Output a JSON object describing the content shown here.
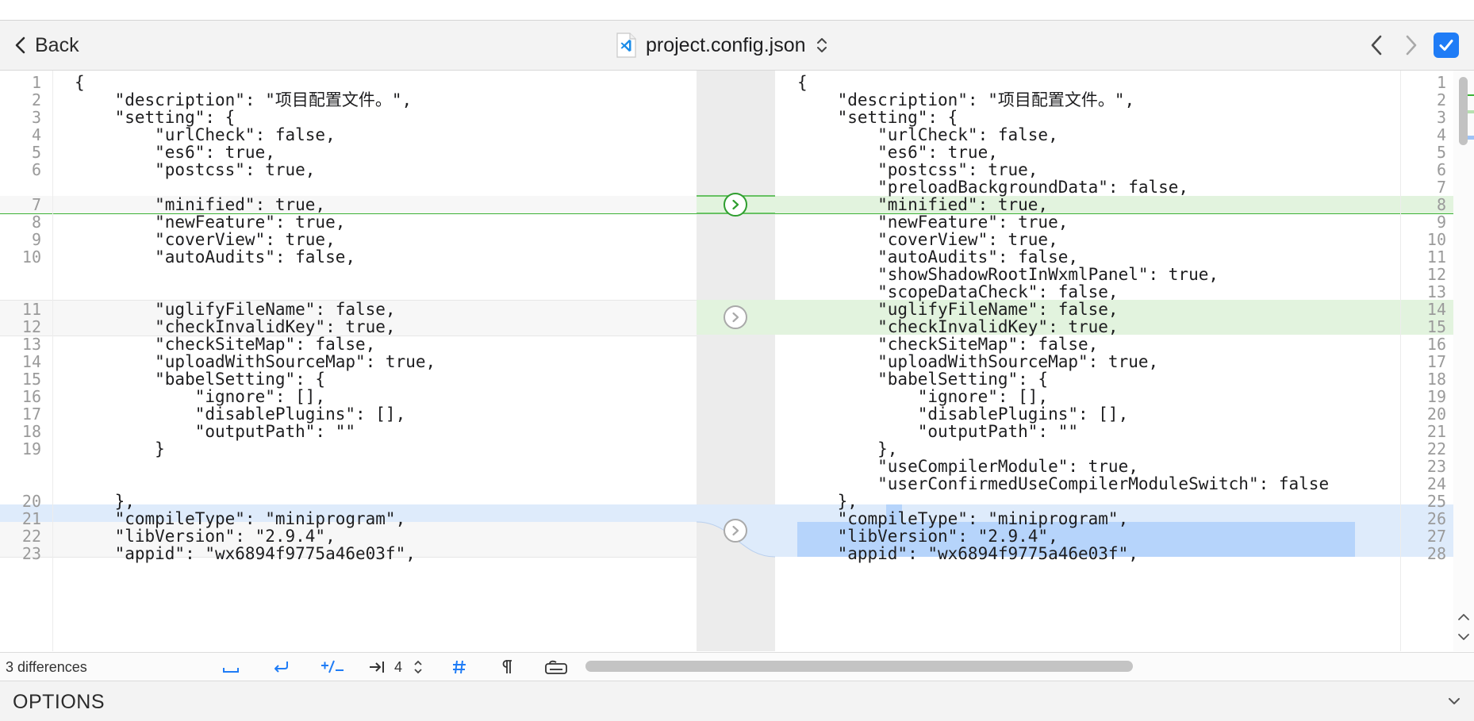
{
  "toolbar": {
    "back_label": "Back",
    "title": "project.config.json",
    "file_icon": "vscode-file-icon",
    "checkbox_checked": true,
    "check_color": "#1f7cf6"
  },
  "colors": {
    "added_bg": "#e2f3de",
    "added_line": "#3db236",
    "selected_bg": "#deebfb",
    "selection_bg": "#b6d4fb"
  },
  "left_lines": [
    {
      "n": "1",
      "t": "{"
    },
    {
      "n": "2",
      "t": "    \"description\": \"项目配置文件。\","
    },
    {
      "n": "3",
      "t": "    \"setting\": {"
    },
    {
      "n": "4",
      "t": "        \"urlCheck\": false,"
    },
    {
      "n": "5",
      "t": "        \"es6\": true,"
    },
    {
      "n": "6",
      "t": "        \"postcss\": true,"
    },
    {
      "n": "7",
      "t": "        \"minified\": true,"
    },
    {
      "n": "8",
      "t": "        \"newFeature\": true,"
    },
    {
      "n": "9",
      "t": "        \"coverView\": true,"
    },
    {
      "n": "10",
      "t": "        \"autoAudits\": false,"
    },
    {
      "n": "11",
      "t": "        \"uglifyFileName\": false,"
    },
    {
      "n": "12",
      "t": "        \"checkInvalidKey\": true,"
    },
    {
      "n": "13",
      "t": "        \"checkSiteMap\": false,"
    },
    {
      "n": "14",
      "t": "        \"uploadWithSourceMap\": true,"
    },
    {
      "n": "15",
      "t": "        \"babelSetting\": {"
    },
    {
      "n": "16",
      "t": "            \"ignore\": [],"
    },
    {
      "n": "17",
      "t": "            \"disablePlugins\": [],"
    },
    {
      "n": "18",
      "t": "            \"outputPath\": \"\""
    },
    {
      "n": "19",
      "t": "        }"
    },
    {
      "n": "20",
      "t": "    },"
    },
    {
      "n": "21",
      "t": "    \"compileType\": \"miniprogram\","
    },
    {
      "n": "22",
      "t": "    \"libVersion\": \"2.9.4\","
    },
    {
      "n": "23",
      "t": "    \"appid\": \"wx6894f9775a46e03f\","
    }
  ],
  "right_lines": [
    {
      "n": "1",
      "t": "{"
    },
    {
      "n": "2",
      "t": "    \"description\": \"项目配置文件。\","
    },
    {
      "n": "3",
      "t": "    \"setting\": {"
    },
    {
      "n": "4",
      "t": "        \"urlCheck\": false,"
    },
    {
      "n": "5",
      "t": "        \"es6\": true,"
    },
    {
      "n": "6",
      "t": "        \"postcss\": true,"
    },
    {
      "n": "7",
      "t": "        \"preloadBackgroundData\": false,"
    },
    {
      "n": "8",
      "t": "        \"minified\": true,"
    },
    {
      "n": "9",
      "t": "        \"newFeature\": true,"
    },
    {
      "n": "10",
      "t": "        \"coverView\": true,"
    },
    {
      "n": "11",
      "t": "        \"autoAudits\": false,"
    },
    {
      "n": "12",
      "t": "        \"showShadowRootInWxmlPanel\": true,"
    },
    {
      "n": "13",
      "t": "        \"scopeDataCheck\": false,"
    },
    {
      "n": "14",
      "t": "        \"uglifyFileName\": false,"
    },
    {
      "n": "15",
      "t": "        \"checkInvalidKey\": true,"
    },
    {
      "n": "16",
      "t": "        \"checkSiteMap\": false,"
    },
    {
      "n": "17",
      "t": "        \"uploadWithSourceMap\": true,"
    },
    {
      "n": "18",
      "t": "        \"babelSetting\": {"
    },
    {
      "n": "19",
      "t": "            \"ignore\": [],"
    },
    {
      "n": "20",
      "t": "            \"disablePlugins\": [],"
    },
    {
      "n": "21",
      "t": "            \"outputPath\": \"\""
    },
    {
      "n": "22",
      "t": "        },"
    },
    {
      "n": "23",
      "t": "        \"useCompilerModule\": true,"
    },
    {
      "n": "24",
      "t": "        \"userConfirmedUseCompilerModuleSwitch\": false"
    },
    {
      "n": "25",
      "t": "    },"
    },
    {
      "n": "26",
      "t": "    \"compileType\": \"miniprogram\","
    },
    {
      "n": "27",
      "t": "    \"libVersion\": \"2.9.4\","
    },
    {
      "n": "28",
      "t": "    \"appid\": \"wx6894f9775a46e03f\","
    }
  ],
  "status": {
    "differences": "3 differences",
    "tab_width": "4",
    "icons": [
      "show-spaces-icon",
      "wrap-lines-icon",
      "diff-marker-icon",
      "tab-indent-icon",
      "line-numbers-icon",
      "paragraph-icon",
      "keyboard-icon"
    ]
  },
  "options": {
    "label": "OPTIONS"
  }
}
